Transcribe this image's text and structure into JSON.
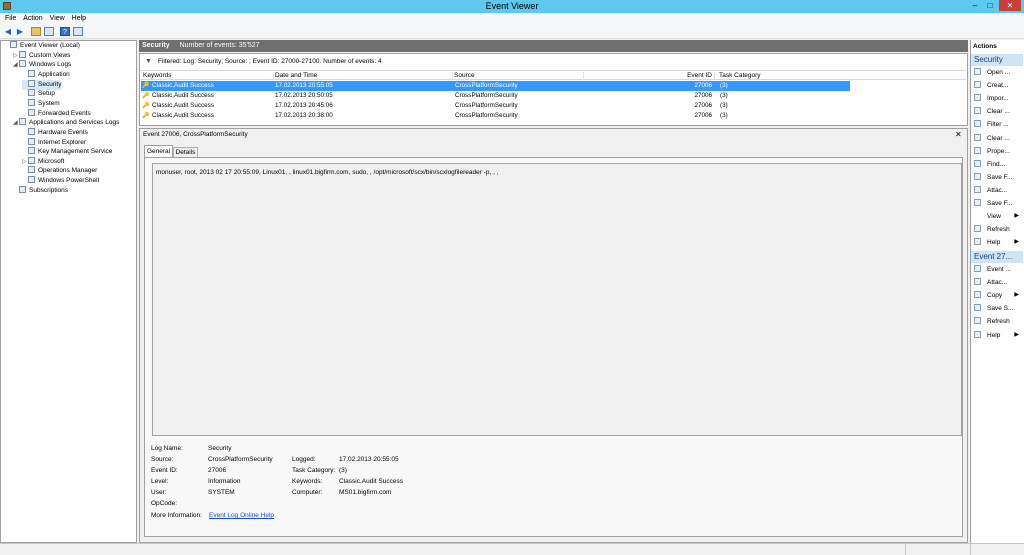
{
  "window": {
    "title": "Event Viewer"
  },
  "menu": [
    "File",
    "Action",
    "View",
    "Help"
  ],
  "tree": [
    {
      "label": "Event Viewer (Local)",
      "indent": 0,
      "exp": ""
    },
    {
      "label": "Custom Views",
      "indent": 1,
      "exp": "▷"
    },
    {
      "label": "Windows Logs",
      "indent": 1,
      "exp": "◢"
    },
    {
      "label": "Application",
      "indent": 2,
      "exp": ""
    },
    {
      "label": "Security",
      "indent": 2,
      "exp": "",
      "selected": true
    },
    {
      "label": "Setup",
      "indent": 2,
      "exp": ""
    },
    {
      "label": "System",
      "indent": 2,
      "exp": ""
    },
    {
      "label": "Forwarded Events",
      "indent": 2,
      "exp": ""
    },
    {
      "label": "Applications and Services Logs",
      "indent": 1,
      "exp": "◢"
    },
    {
      "label": "Hardware Events",
      "indent": 2,
      "exp": ""
    },
    {
      "label": "Internet Explorer",
      "indent": 2,
      "exp": ""
    },
    {
      "label": "Key Management Service",
      "indent": 2,
      "exp": ""
    },
    {
      "label": "Microsoft",
      "indent": 2,
      "exp": "▷"
    },
    {
      "label": "Operations Manager",
      "indent": 2,
      "exp": ""
    },
    {
      "label": "Windows PowerShell",
      "indent": 2,
      "exp": ""
    },
    {
      "label": "Subscriptions",
      "indent": 1,
      "exp": ""
    }
  ],
  "log": {
    "name": "Security",
    "count": "Number of events: 35'527",
    "filter": "Filtered: Log: Security; Source: ; Event ID: 27000-27100. Number of events: 4"
  },
  "columns": [
    "Keywords",
    "Date and Time",
    "Source",
    "Event ID",
    "Task Category"
  ],
  "rows": [
    {
      "keywords": "Classic,Audit Success",
      "date": "17.02.2013 20:55:05",
      "source": "CrossPlatformSecurity",
      "id": "27006",
      "task": "(3)",
      "selected": true
    },
    {
      "keywords": "Classic,Audit Success",
      "date": "17.02.2013 20:50:05",
      "source": "CrossPlatformSecurity",
      "id": "27006",
      "task": "(3)"
    },
    {
      "keywords": "Classic,Audit Success",
      "date": "17.02.2013 20:45:06",
      "source": "CrossPlatformSecurity",
      "id": "27006",
      "task": "(3)"
    },
    {
      "keywords": "Classic,Audit Success",
      "date": "17.02.2013 20:38:00",
      "source": "CrossPlatformSecurity",
      "id": "27006",
      "task": "(3)"
    }
  ],
  "detail": {
    "title": "Event 27006, CrossPlatformSecurity",
    "tabs": {
      "general": "General",
      "details": "Details"
    },
    "message": "monuser, root, 2013 02 17 20:55:09, Linux01, , linux01.bigfirm.com, sudo, , /opt/microsoft/scx/bin/scxlogfilereader -p, , ,",
    "labels": {
      "logname": "Log Name:",
      "source": "Source:",
      "eventid": "Event ID:",
      "level": "Level:",
      "user": "User:",
      "opcode": "OpCode:",
      "more": "More Information:",
      "logged": "Logged:",
      "taskcat": "Task Category:",
      "keywords": "Keywords:",
      "computer": "Computer:"
    },
    "values": {
      "logname": "Security",
      "source": "CrossPlatformSecurity",
      "eventid": "27006",
      "level": "Information",
      "user": "SYSTEM",
      "opcode": "",
      "more": "Event Log Online Help",
      "logged": "17.02.2013 20:55:05",
      "taskcat": "(3)",
      "keywords": "Classic,Audit Success",
      "computer": "MS01.bigfirm.com"
    }
  },
  "actions": {
    "title": "Actions",
    "section1": "Security",
    "items1": [
      {
        "label": "Open ...",
        "icon": "folder-open-icon"
      },
      {
        "label": "Creat...",
        "icon": "filter-create-icon"
      },
      {
        "label": "Impor...",
        "icon": "import-icon"
      },
      {
        "label": "Clear ...",
        "icon": "clear-icon"
      },
      {
        "label": "Filter ...",
        "icon": "filter-icon"
      },
      {
        "label": "Clear ...",
        "icon": "clear-filter-icon"
      },
      {
        "label": "Prope...",
        "icon": "properties-icon"
      },
      {
        "label": "Find...",
        "icon": "find-icon"
      },
      {
        "label": "Save F...",
        "icon": "save-icon"
      },
      {
        "label": "Attac...",
        "icon": "attach-icon"
      },
      {
        "label": "Save F...",
        "icon": "save-icon"
      },
      {
        "label": "View",
        "icon": "blank-icon",
        "sub": true
      },
      {
        "label": "Refresh",
        "icon": "refresh-icon"
      },
      {
        "label": "Help",
        "icon": "help-icon",
        "sub": true
      }
    ],
    "section2": "Event 27...",
    "items2": [
      {
        "label": "Event ...",
        "icon": "event-properties-icon"
      },
      {
        "label": "Attac...",
        "icon": "attach-task-icon"
      },
      {
        "label": "Copy",
        "icon": "copy-icon",
        "sub": true
      },
      {
        "label": "Save S...",
        "icon": "save-icon"
      },
      {
        "label": "Refresh",
        "icon": "refresh-icon"
      },
      {
        "label": "Help",
        "icon": "help-icon",
        "sub": true
      }
    ]
  }
}
